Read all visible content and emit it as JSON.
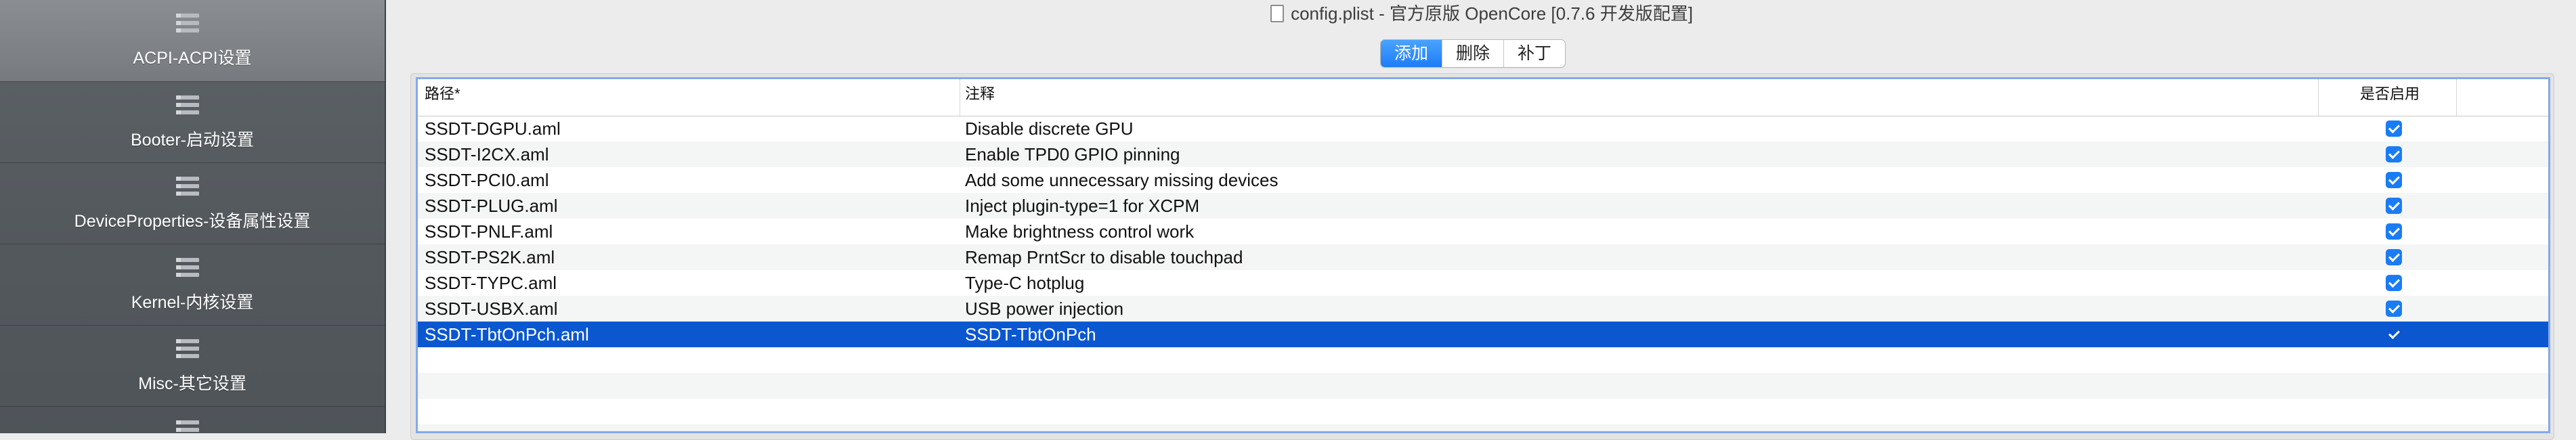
{
  "window": {
    "title": "config.plist - 官方原版 OpenCore [0.7.6 开发版配置]"
  },
  "sidebar": {
    "items": [
      {
        "label": "ACPI-ACPI设置",
        "icon": "list-icon",
        "active": true
      },
      {
        "label": "Booter-启动设置",
        "icon": "list-icon"
      },
      {
        "label": "DeviceProperties-设备属性设置",
        "icon": "list-icon"
      },
      {
        "label": "Kernel-内核设置",
        "icon": "list-icon"
      },
      {
        "label": "Misc-其它设置",
        "icon": "list-icon"
      }
    ]
  },
  "tabs": [
    {
      "label": "添加",
      "selected": true
    },
    {
      "label": "删除"
    },
    {
      "label": "补丁"
    }
  ],
  "table": {
    "columns": {
      "path": "路径*",
      "comment": "注释",
      "enabled": "是否启用"
    },
    "rows": [
      {
        "path": "SSDT-DGPU.aml",
        "comment": "Disable discrete GPU",
        "enabled": true
      },
      {
        "path": "SSDT-I2CX.aml",
        "comment": "Enable TPD0 GPIO pinning",
        "enabled": true
      },
      {
        "path": "SSDT-PCI0.aml",
        "comment": "Add some unnecessary missing devices",
        "enabled": true
      },
      {
        "path": "SSDT-PLUG.aml",
        "comment": "Inject plugin-type=1 for XCPM",
        "enabled": true
      },
      {
        "path": "SSDT-PNLF.aml",
        "comment": "Make brightness control work",
        "enabled": true
      },
      {
        "path": "SSDT-PS2K.aml",
        "comment": "Remap PrntScr to disable touchpad",
        "enabled": true
      },
      {
        "path": "SSDT-TYPC.aml",
        "comment": "Type-C hotplug",
        "enabled": true
      },
      {
        "path": "SSDT-USBX.aml",
        "comment": "USB power injection",
        "enabled": true
      },
      {
        "path": "SSDT-TbtOnPch.aml",
        "comment": "SSDT-TbtOnPch",
        "enabled": true,
        "selected": true
      }
    ]
  },
  "colors": {
    "selection": "#0a57d0",
    "accent": "#1a7cf5",
    "sidebar": "#54595e"
  }
}
